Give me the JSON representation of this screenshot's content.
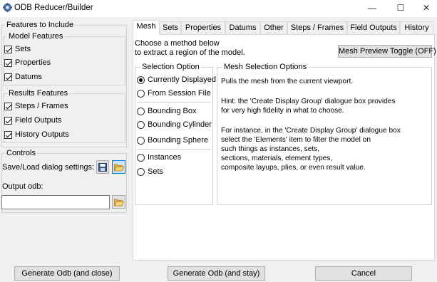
{
  "window": {
    "title": "ODB Reducer/Builder",
    "minimize_glyph": "—",
    "maximize_glyph": "☐",
    "close_glyph": "✕",
    "app_icon": "gear-icon"
  },
  "left": {
    "features": {
      "title": "Features to Include",
      "model": {
        "title": "Model Features",
        "items": [
          {
            "label": "Sets",
            "checked": true
          },
          {
            "label": "Properties",
            "checked": true
          },
          {
            "label": "Datums",
            "checked": true
          }
        ]
      },
      "results": {
        "title": "Results Features",
        "items": [
          {
            "label": "Steps / Frames",
            "checked": true
          },
          {
            "label": "Field Outputs",
            "checked": true
          },
          {
            "label": "History Outputs",
            "checked": true
          }
        ]
      }
    },
    "controls": {
      "title": "Controls",
      "save_load_label": "Save/Load dialog settings:",
      "save_icon": "save-icon",
      "open_icon": "folder-open-icon",
      "output_odb_label": "Output odb:",
      "output_odb_value": "",
      "browse_icon": "folder-open-icon"
    }
  },
  "tabs": [
    {
      "label": "Mesh",
      "active": true
    },
    {
      "label": "Sets",
      "active": false
    },
    {
      "label": "Properties",
      "active": false
    },
    {
      "label": "Datums",
      "active": false
    },
    {
      "label": "Other",
      "active": false
    },
    {
      "label": "Steps / Frames",
      "active": false
    },
    {
      "label": "Field Outputs",
      "active": false
    },
    {
      "label": "History",
      "active": false
    }
  ],
  "mesh": {
    "intro_line1": "Choose a method below",
    "intro_line2": "to extract a region of the model.",
    "preview_toggle": "Mesh Preview Toggle (OFF)",
    "selection": {
      "title": "Selection Option",
      "options": [
        {
          "label": "Currently Displayed",
          "checked": true
        },
        {
          "label": "From Session File",
          "checked": false
        },
        {
          "label": "Bounding Box",
          "checked": false
        },
        {
          "label": "Bounding Cylinder",
          "checked": false
        },
        {
          "label": "Bounding Sphere",
          "checked": false
        },
        {
          "label": "Instances",
          "checked": false
        },
        {
          "label": "Sets",
          "checked": false
        }
      ]
    },
    "options_panel": {
      "title": "Mesh Selection Options",
      "lines": [
        "Pulls the mesh from the current viewport.",
        "",
        "Hint: the 'Create Display Group' dialogue box provides",
        "for very high fidelity in what to choose.",
        "",
        "For instance, in the 'Create Display Group' dialogue box",
        "select the 'Elements' item to filter the model on",
        "such things as instances, sets,",
        "sections, materials, element types,",
        "composite layups, plies, or even result value."
      ]
    }
  },
  "buttons": {
    "generate_close": "Generate Odb (and close)",
    "generate_stay": "Generate Odb (and stay)",
    "cancel": "Cancel"
  }
}
